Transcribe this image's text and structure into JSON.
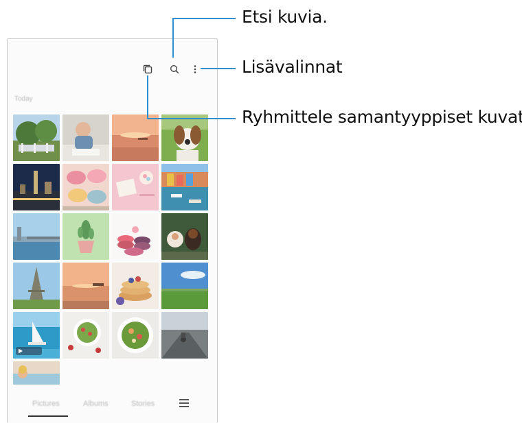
{
  "callouts": {
    "search": "Etsi kuvia.",
    "more_options": "Lisävalinnat",
    "group_similar": "Ryhmittele samantyyppiset kuvat."
  },
  "toolbar": {
    "icons": [
      "group-similar-icon",
      "search-icon",
      "more-options-icon"
    ]
  },
  "gallery": {
    "section_label": "Today",
    "thumbnails": [
      "park-trees",
      "baby-painting",
      "sunset-sea",
      "beagle-dog",
      "city-night",
      "macarons",
      "desk-flatlay",
      "harbor-boats",
      "river-bridge",
      "cactus-plant",
      "macaron-stack",
      "kitten-and-dog",
      "eiffel-tower",
      "sunset-pier",
      "pancakes",
      "green-field",
      "sailboat-video",
      "salad-bowl-1",
      "salad-bowl-2",
      "cyclist-road",
      "beach-portrait"
    ]
  },
  "tabs": {
    "items": [
      "Pictures",
      "Albums",
      "Stories"
    ],
    "active": "Pictures"
  },
  "colors": {
    "leader_line": "#2f8fd1",
    "frame": "#c9c9c9"
  }
}
